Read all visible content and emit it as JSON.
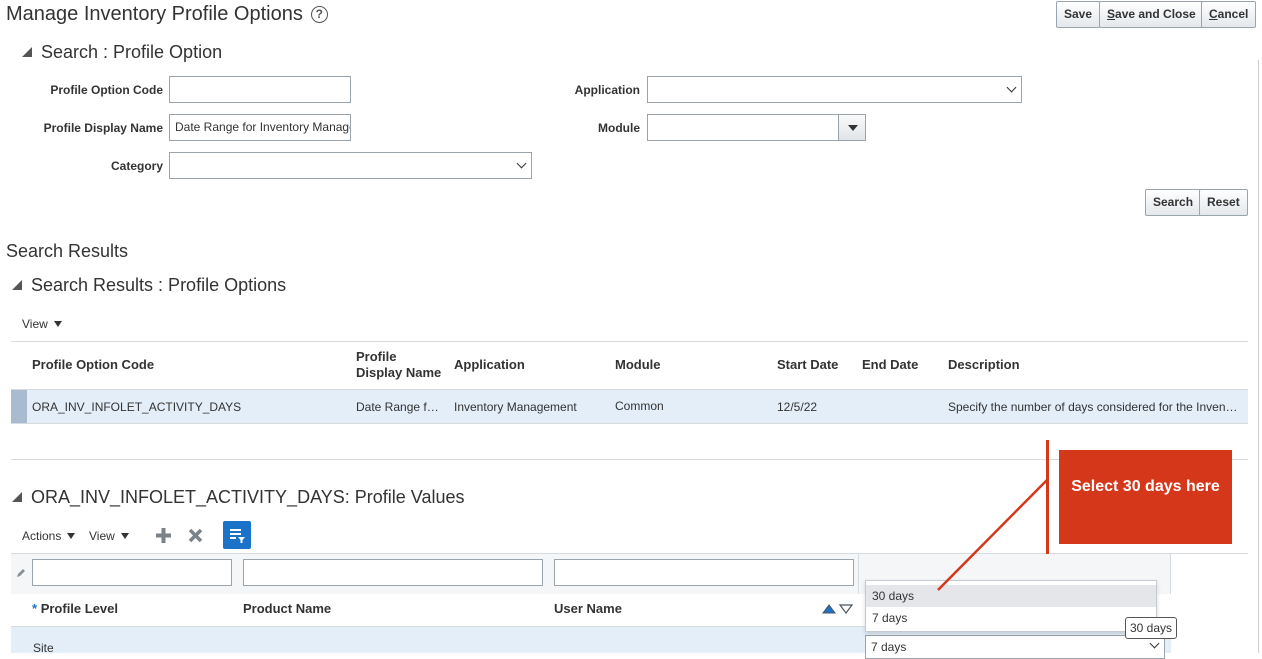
{
  "page": {
    "title": "Manage Inventory Profile Options",
    "help_icon": "help-icon"
  },
  "toolbar": {
    "save": "Save",
    "save_and_close_prefix": "S",
    "save_and_close_rest": "ave and Close",
    "cancel_prefix": "C",
    "cancel_rest": "ancel"
  },
  "search": {
    "heading": "Search : Profile Option",
    "profile_option_code_label": "Profile Option Code",
    "profile_option_code_value": "",
    "profile_display_name_label": "Profile Display Name",
    "profile_display_name_value": "Date Range for Inventory Management",
    "category_label": "Category",
    "category_value": "",
    "application_label": "Application",
    "application_value": "",
    "module_label": "Module",
    "module_value": "",
    "search_button": "Search",
    "reset_button": "Reset"
  },
  "results": {
    "heading": "Search Results",
    "subheading": "Search Results : Profile Options",
    "view_menu": "View",
    "columns": {
      "code": "Profile Option Code",
      "display_name_line1": "Profile",
      "display_name_line2": "Display Name",
      "application": "Application",
      "module": "Module",
      "start_date": "Start Date",
      "end_date": "End Date",
      "description": "Description"
    },
    "rows": [
      {
        "code": "ORA_INV_INFOLET_ACTIVITY_DAYS",
        "display_name": "Date Range f…",
        "application": "Inventory Management",
        "module": "Common",
        "start_date": "12/5/22",
        "end_date": "",
        "description": "Specify the number of days considered for the Inven…"
      }
    ]
  },
  "profile_values": {
    "heading": "ORA_INV_INFOLET_ACTIVITY_DAYS: Profile Values",
    "actions_menu": "Actions",
    "view_menu": "View",
    "add_icon": "plus-icon",
    "delete_icon": "x-icon",
    "filter_icon": "query-by-example-icon",
    "required_marker": "*",
    "columns": {
      "profile_level": "Profile Level",
      "product_name": "Product Name",
      "user_name": "User Name"
    },
    "row": {
      "profile_level": "Site",
      "value": "7 days"
    },
    "dropdown_options": [
      "30 days",
      "7 days"
    ],
    "tooltip": "30 days"
  },
  "annotation": {
    "callout_text": "Select  30 days here",
    "color": "#d5371a"
  }
}
